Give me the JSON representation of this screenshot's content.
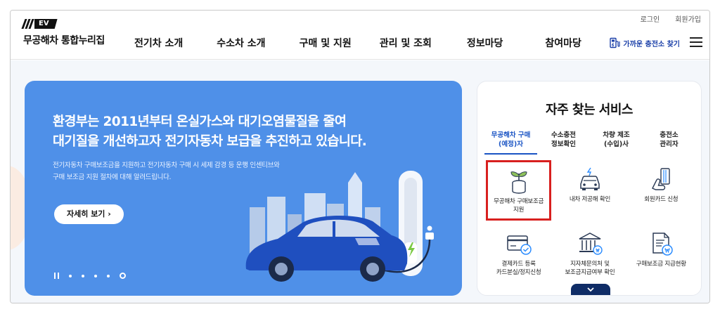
{
  "header": {
    "logo_badge": "EV",
    "logo_text": "무공해차 통합누리집",
    "nav": [
      "전기차 소개",
      "수소차 소개",
      "구매 및 지원",
      "관리 및 조회",
      "정보마당",
      "참여마당"
    ],
    "util_login": "로그인",
    "util_join": "회원가입",
    "find_charger": "가까운 충전소 찾기",
    "menu_icon": "hamburger-icon",
    "charger_icon": "charger-station-icon"
  },
  "hero": {
    "title_line1": "환경부는 2011년부터 온실가스와 대기오염물질을 줄여",
    "title_line2": "대기질을 개선하고자 전기자동차 보급을 추진하고 있습니다.",
    "desc_line1": "전기자동차 구매보조금을 지원하고 전기자동차 구매 시 세제 감경 등 운행 인센티브와",
    "desc_line2": "구매 보조금 지원 절차에 대해 알려드립니다.",
    "button_label": "자세히 보기 ›",
    "slide_count": 5,
    "active_slide": 5
  },
  "services": {
    "title": "자주 찾는 서비스",
    "tabs": [
      {
        "line1": "무공해차 구매",
        "line2": "(예정)자",
        "active": true
      },
      {
        "line1": "수소충전",
        "line2": "정보확인",
        "active": false
      },
      {
        "line1": "차량 제조",
        "line2": "(수입)사",
        "active": false
      },
      {
        "line1": "충전소",
        "line2": "관리자",
        "active": false
      }
    ],
    "items": [
      {
        "line1": "무공해차 구매보조금",
        "line2": "지원",
        "icon": "money-plant-icon",
        "highlighted": true
      },
      {
        "line1": "내차 저공해 확인",
        "line2": "",
        "icon": "car-check-icon",
        "highlighted": false
      },
      {
        "line1": "회원카드 신청",
        "line2": "",
        "icon": "card-hand-icon",
        "highlighted": false
      },
      {
        "line1": "결제카드 등록",
        "line2": "카드분실/정지신청",
        "icon": "card-check-icon",
        "highlighted": false
      },
      {
        "line1": "지자체문의처 및",
        "line2": "보조금지급여부 확인",
        "icon": "government-building-icon",
        "highlighted": false
      },
      {
        "line1": "구매보조금 지급현황",
        "line2": "",
        "icon": "document-won-icon",
        "highlighted": false
      }
    ],
    "more_icon": "chevron-down-icon"
  },
  "colors": {
    "hero_bg": "#4f90e8",
    "accent": "#1a54c4",
    "highlight_border": "#d8201f",
    "dark_navy": "#0f2c66"
  }
}
